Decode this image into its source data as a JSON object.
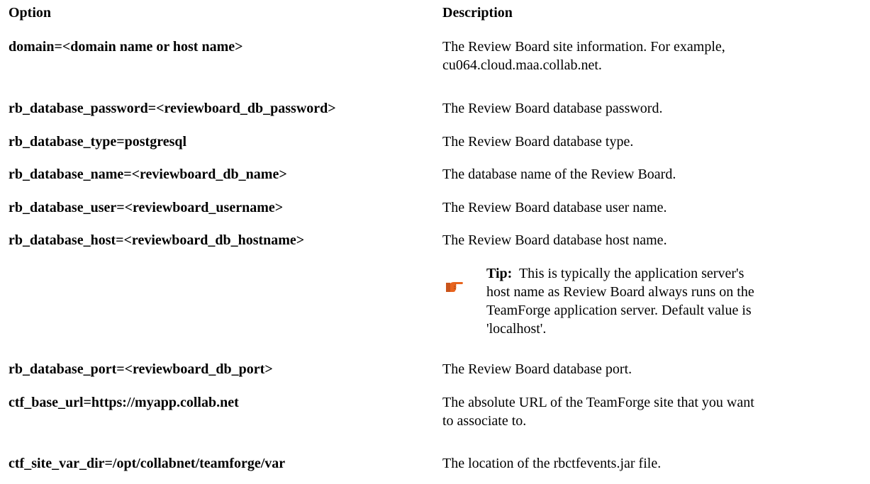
{
  "header": {
    "option": "Option",
    "description": "Description"
  },
  "rows": [
    {
      "option": "domain=<domain name or host name>",
      "description_line1": "The Review Board site information. For example,",
      "description_line2": "cu064.cloud.maa.collab.net."
    },
    {
      "option": "rb_database_password=<reviewboard_db_password>",
      "description": "The Review Board database password."
    },
    {
      "option": "rb_database_type=postgresql",
      "description": "The Review Board database type."
    },
    {
      "option": "rb_database_name=<reviewboard_db_name>",
      "description": "The database name of the Review Board."
    },
    {
      "option": "rb_database_user=<reviewboard_username>",
      "description": "The Review Board database user name."
    },
    {
      "option": "rb_database_host=<reviewboard_db_hostname>",
      "description": "The Review Board database host name."
    },
    {
      "option": "rb_database_port=<reviewboard_db_port>",
      "description": "The Review Board database port."
    },
    {
      "option": "ctf_base_url=https://myapp.collab.net",
      "description_line1": "The absolute URL of the TeamForge site that you want",
      "description_line2": "to associate to."
    },
    {
      "option": "ctf_site_var_dir=/opt/collabnet/teamforge/var",
      "description": "The location of the rbctfevents.jar file."
    }
  ],
  "tip": {
    "icon": "pointing-hand-icon",
    "label": "Tip:",
    "line1": "This is typically the application server's",
    "line2": "host name as Review Board always runs on the",
    "line3": "TeamForge application server. Default value is",
    "line4": "'localhost'."
  },
  "colors": {
    "text": "#000000",
    "icon": "#e8641e"
  }
}
